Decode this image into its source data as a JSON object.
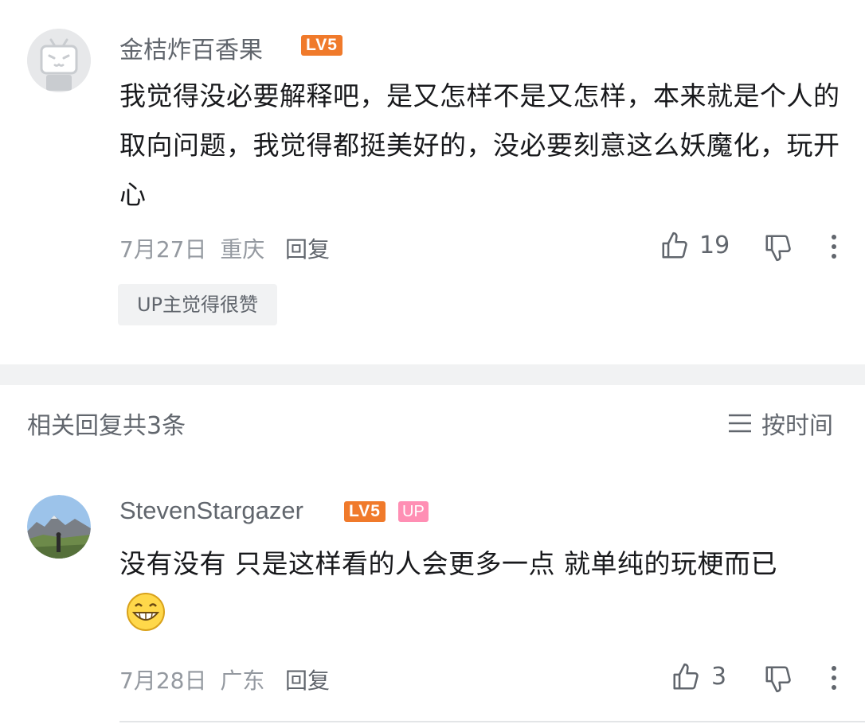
{
  "comment1": {
    "username": "金桔炸百香果",
    "level_badge": "LV5",
    "content": "我觉得没必要解释吧，是又怎样不是又怎样，本来就是个人的取向问题，我觉得都挺美好的，没必要刻意这么妖魔化，玩开心",
    "date": "7月27日",
    "location": "重庆",
    "reply_label": "回复",
    "like_count": "19",
    "up_tag": "UP主觉得很赞"
  },
  "replies_section": {
    "header": "相关回复共3条",
    "sort_label": "按时间"
  },
  "comment2": {
    "username": "StevenStargazer",
    "level_badge": "LV5",
    "up_badge": "UP",
    "content": "没有没有 只是这样看的人会更多一点 就单纯的玩梗而已",
    "emoji": "grinning-emoji",
    "date": "7月28日",
    "location": "广东",
    "reply_label": "回复",
    "like_count": "3"
  },
  "colors": {
    "level_badge": "#f07a2b",
    "up_badge": "#ff8fb4",
    "divider": "#f1f2f3"
  }
}
